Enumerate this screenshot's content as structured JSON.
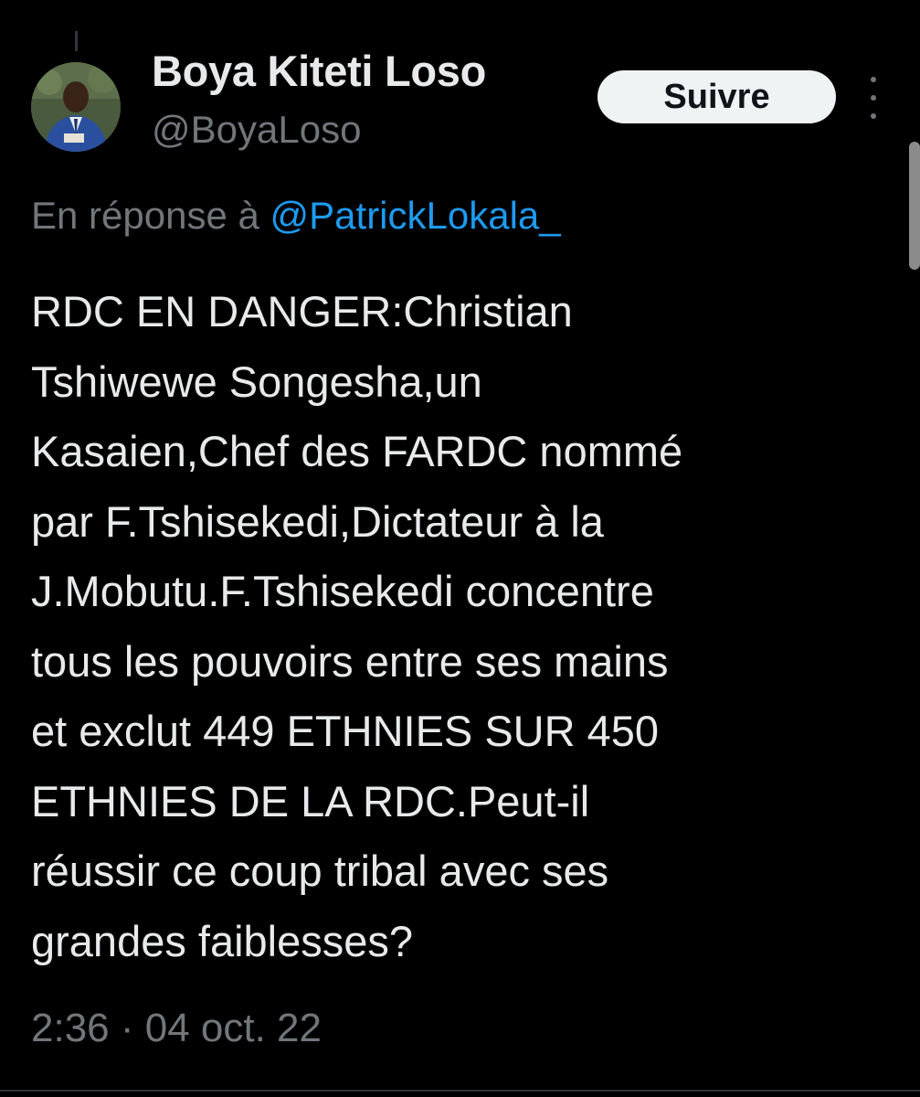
{
  "author": {
    "display_name": "Boya Kiteti Loso",
    "handle": "@BoyaLoso"
  },
  "actions": {
    "follow_label": "Suivre",
    "more_icon": "more-vertical-icon"
  },
  "reply_context": {
    "prefix": "En réponse à ",
    "mention": "@PatrickLokala_"
  },
  "tweet": {
    "lines": [
      "RDC EN DANGER:Christian",
      "Tshiwewe Songesha,un",
      "Kasaien,Chef des FARDC nommé",
      "par F.Tshisekedi,Dictateur à la",
      "J.Mobutu.F.Tshisekedi concentre",
      "tous les pouvoirs entre ses mains",
      "et exclut 449 ETHNIES SUR 450",
      "ETHNIES DE LA RDC.Peut-il",
      "réussir ce coup tribal avec ses",
      "grandes faiblesses?"
    ],
    "timestamp": "2:36 · 04 oct. 22"
  },
  "colors": {
    "background": "#000000",
    "text_primary": "#e7e9ea",
    "text_secondary": "#71767b",
    "link": "#1d9bf0",
    "button_bg": "#eff3f4",
    "button_text": "#0f1419"
  }
}
